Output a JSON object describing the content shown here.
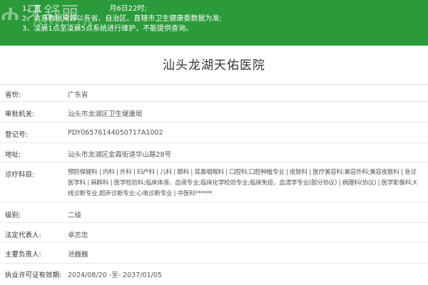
{
  "notice": {
    "lines": [
      "1、直辖市数据更新至2024年6月6日22时;",
      "2、信息数据来源以各省、自治区、直辖市卫生健康委数据为准;",
      "3、凌晨1点至凌晨5点系统进行维护，不能提供查询。"
    ],
    "line1_prefix": "1、直",
    "line1_suffix": "月6日22时;",
    "line2": "2、信息数据来源以各省、自治区、直辖市卫生健康委数据为准;",
    "line3": "3、凌晨1点至凌晨5点系统进行维护，不能提供查询。",
    "background_color": "#2a9a3a"
  },
  "watermark": {
    "logo": "ሐ",
    "name": "牙舒丽",
    "url": "yashuli.com"
  },
  "hospital": {
    "name": "汕头龙湖天佑医院"
  },
  "fields": [
    {
      "label": "省份:",
      "value": "广东省"
    },
    {
      "label": "审批机关:",
      "value": "汕头市龙湖区卫生健康局"
    },
    {
      "label": "登记号:",
      "value": "PDY06576144050717A1002"
    },
    {
      "label": "地址:",
      "value": "汕头市龙湖区金霞街道华山路28号"
    },
    {
      "label": "诊疗科目:",
      "value": "预防保健科 | 内科 | 外科 | 妇产科 | 儿科 | 眼科 | 耳鼻咽喉科 | 口腔科;口腔种植专业 | 皮肤科 | 医疗美容科;美容外科;美容皮肤科 | 急诊医学科 | 麻醉科 | 医学检验科;临床体液、血液专业;临床化学检验专业;临床免疫、血清学专业(部分协议) | 病理科(协议) | 医学影像科;X线诊断专业;超声诊断专业;心电诊断专业 | 中医科******"
    },
    {
      "label": "级别:",
      "value": "二级"
    },
    {
      "label": "法定代表人:",
      "value": "卓志忠"
    },
    {
      "label": "主要负责人:",
      "value": "池巍巍"
    },
    {
      "label": "执业许可证有效期:",
      "value": "2024/08/20 -至- 2037/01/05"
    }
  ]
}
